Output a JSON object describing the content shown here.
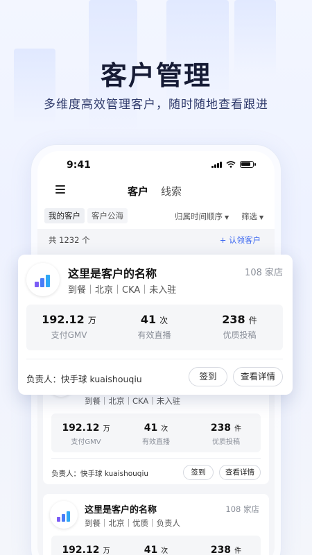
{
  "hero": {
    "title": "客户管理",
    "subtitle": "多维度高效管理客户，随时随地查看跟进"
  },
  "status_bar": {
    "time": "9:41"
  },
  "nav": {
    "tabs": [
      {
        "label": "客户",
        "active": true
      },
      {
        "label": "线索",
        "active": false
      }
    ]
  },
  "filters": {
    "chips": [
      "我的客户",
      "客户公海"
    ],
    "sort_label": "归属时间顺序",
    "filter_label": "筛选"
  },
  "list": {
    "count_text": "共 1232 个",
    "claim_label": "+ 认领客户"
  },
  "cards": [
    {
      "name": "这里是客户的名称",
      "stores": "108 家店",
      "tags": "到餐｜北京｜CKA｜未入驻",
      "stats": [
        {
          "value": "192.12",
          "unit": "万",
          "label": "支付GMV"
        },
        {
          "value": "41",
          "unit": "次",
          "label": "有效直播"
        },
        {
          "value": "238",
          "unit": "件",
          "label": "优质投稿"
        }
      ],
      "owner": "负责人：快手球 kuaishouqiu",
      "btn_checkin": "签到",
      "btn_detail": "查看详情"
    },
    {
      "tags": "到餐｜北京｜CKA｜未入驻",
      "stats": [
        {
          "value": "192.12",
          "unit": "万",
          "label": "支付GMV"
        },
        {
          "value": "41",
          "unit": "次",
          "label": "有效直播"
        },
        {
          "value": "238",
          "unit": "件",
          "label": "优质投稿"
        }
      ],
      "owner": "负责人：快手球 kuaishouqiu",
      "btn_checkin": "签到",
      "btn_detail": "查看详情"
    },
    {
      "name": "这里是客户的名称",
      "stores": "108 家店",
      "tags": "到餐｜北京｜优质｜负责人",
      "stats": [
        {
          "value": "192.12",
          "unit": "万"
        },
        {
          "value": "41",
          "unit": "次"
        },
        {
          "value": "238",
          "unit": "件"
        }
      ]
    }
  ],
  "colors": {
    "accent": "#3a66f0",
    "logo_bar_1": "#7b5cf5",
    "logo_bar_2": "#4a7cf7",
    "logo_bar_3": "#2fa8f5"
  }
}
